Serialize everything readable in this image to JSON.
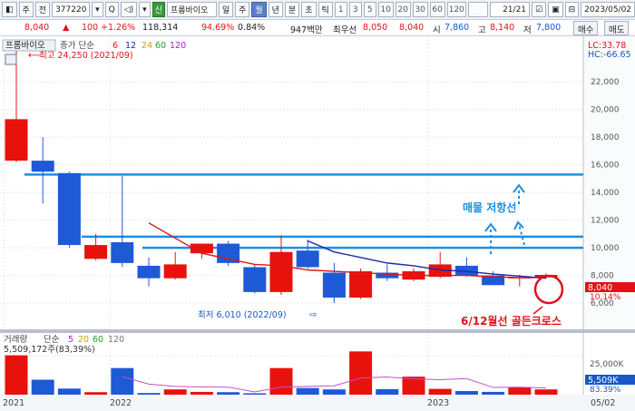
{
  "toolbar": {
    "menu_label": "주",
    "all_label": "전",
    "code": "377220",
    "search_label": "Q",
    "new_badge": "신",
    "name": "프롬바이오",
    "periods": [
      "일",
      "주",
      "월",
      "년",
      "분",
      "초",
      "틱"
    ],
    "active_period": "월",
    "intervals": [
      "1",
      "3",
      "5",
      "10",
      "20",
      "30",
      "60",
      "120"
    ],
    "page": "21",
    "page_total": "/21",
    "date": "2023/05/02"
  },
  "quote": {
    "price": "8,040",
    "change": "100",
    "change_pct": "+1.26%",
    "volume": "118,314",
    "ratio": "94.69%",
    "turnover": "0.84%",
    "amount": "947백만",
    "best_label": "최우선",
    "ask": "8,050",
    "bid": "8,040",
    "open_label": "시",
    "open": "7,860",
    "high_label": "고",
    "high": "8,140",
    "low_label": "저",
    "low": "7,800",
    "buy_label": "매수",
    "sell_label": "매도"
  },
  "price_panel": {
    "legend_name": "프롬바이오",
    "legend_type": "종가 단순",
    "ma_periods": [
      "6",
      "12",
      "24",
      "60",
      "120"
    ],
    "ma_colors": [
      "#d81818",
      "#1a2aa6",
      "#c8a400",
      "#2aa02a",
      "#a020d0"
    ],
    "lc_label": "LC:33.78",
    "hc_label": "HC:-66.65",
    "high_note": "최고 24,250 (2021/09)",
    "low_note": "최저 6,010 (2022/09)",
    "low_arrow": "⇨",
    "resistance_note": "매물 저항선",
    "cross_note": "6/12월선 골든크로스",
    "current_price": "8,040",
    "current_pct": "10.14%"
  },
  "volume_panel": {
    "legend_title": "거래량",
    "legend_type": "단순",
    "ma_periods": [
      "5",
      "20",
      "60",
      "120"
    ],
    "info": "5,509,172주(83,39%)",
    "axis_labels": [
      "25,000K"
    ],
    "current_label": "5,509K",
    "current_pct": "83.39%"
  },
  "x_axis": {
    "labels": [
      "2021",
      "2022",
      "2023",
      "05/02"
    ]
  },
  "chart_data": {
    "type": "candlestick",
    "y_ticks": [
      22000,
      20000,
      18000,
      16000,
      14000,
      12000,
      10000,
      8000,
      6000
    ],
    "ylim": [
      4300,
      24900
    ],
    "candles": [
      {
        "o": 16300,
        "h": 24250,
        "l": 16200,
        "c": 19300
      },
      {
        "o": 16300,
        "h": 18000,
        "l": 13200,
        "c": 15500
      },
      {
        "o": 15400,
        "h": 15500,
        "l": 10000,
        "c": 10200
      },
      {
        "o": 9200,
        "h": 11000,
        "l": 9100,
        "c": 10200
      },
      {
        "o": 10400,
        "h": 15200,
        "l": 8600,
        "c": 8900
      },
      {
        "o": 8700,
        "h": 9300,
        "l": 7200,
        "c": 7800
      },
      {
        "o": 7800,
        "h": 9700,
        "l": 7700,
        "c": 8800
      },
      {
        "o": 9600,
        "h": 10300,
        "l": 9200,
        "c": 10300
      },
      {
        "o": 10300,
        "h": 10500,
        "l": 8700,
        "c": 8900
      },
      {
        "o": 8600,
        "h": 8800,
        "l": 6700,
        "c": 6800
      },
      {
        "o": 6800,
        "h": 10900,
        "l": 6600,
        "c": 9700
      },
      {
        "o": 9800,
        "h": 10600,
        "l": 8500,
        "c": 8600
      },
      {
        "o": 8200,
        "h": 8900,
        "l": 6010,
        "c": 6400
      },
      {
        "o": 6400,
        "h": 8500,
        "l": 6300,
        "c": 8300
      },
      {
        "o": 8200,
        "h": 8800,
        "l": 7600,
        "c": 7800
      },
      {
        "o": 7700,
        "h": 8500,
        "l": 7600,
        "c": 8300
      },
      {
        "o": 7900,
        "h": 9700,
        "l": 7800,
        "c": 8800
      },
      {
        "o": 8700,
        "h": 9300,
        "l": 7900,
        "c": 8000
      },
      {
        "o": 8000,
        "h": 8300,
        "l": 7300,
        "c": 7300
      },
      {
        "o": 7850,
        "h": 8050,
        "l": 7200,
        "c": 7850
      },
      {
        "o": 7860,
        "h": 8140,
        "l": 7800,
        "c": 8040
      }
    ],
    "ma6": [
      null,
      null,
      null,
      null,
      null,
      11800,
      10700,
      9600,
      9200,
      8800,
      8700,
      8400,
      8300,
      8200,
      8100,
      8000,
      8000,
      8000,
      7900,
      7850,
      7850
    ],
    "ma12": [
      null,
      null,
      null,
      null,
      null,
      null,
      null,
      null,
      null,
      null,
      null,
      10500,
      9700,
      9300,
      8900,
      8700,
      8400,
      8300,
      8100,
      7950,
      7800
    ],
    "volume": [
      14200,
      5400,
      2200,
      900,
      9600,
      600,
      1900,
      1000,
      900,
      500,
      9600,
      2400,
      1900,
      15600,
      2000,
      6500,
      2100,
      1300,
      1000,
      2700,
      1900
    ],
    "volume_ylim": [
      0,
      18000
    ],
    "volume_ma": [
      null,
      null,
      null,
      null,
      6500,
      3800,
      3000,
      2800,
      2700,
      1000,
      2700,
      3000,
      3200,
      6000,
      6400,
      5700,
      5400,
      5800,
      2600,
      2700,
      2400
    ],
    "resistance_lines": [
      {
        "y": 15300,
        "x0": 27,
        "x1": 643
      },
      {
        "y": 10800,
        "x0": 90,
        "x1": 643
      },
      {
        "y": 10000,
        "x0": 157,
        "x1": 643
      }
    ],
    "x_tick_index": {
      "2021": 0,
      "2022": 4,
      "2023": 16
    }
  }
}
